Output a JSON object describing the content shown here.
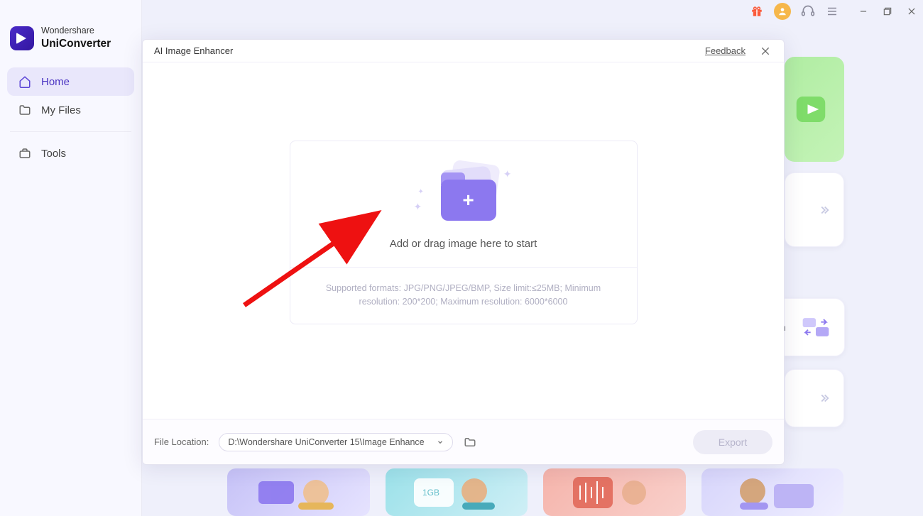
{
  "brand": {
    "line1": "Wondershare",
    "line2": "UniConverter"
  },
  "sidebar": {
    "items": [
      {
        "label": "Home",
        "icon": "home-icon",
        "active": true
      },
      {
        "label": "My Files",
        "icon": "folder-icon",
        "active": false
      },
      {
        "label": "Tools",
        "icon": "toolbox-icon",
        "active": false
      }
    ]
  },
  "modal": {
    "title": "AI Image Enhancer",
    "feedback_label": "Feedback",
    "drop_prompt": "Add or drag image here to start",
    "format_hint": "Supported formats: JPG/PNG/JPEG/BMP, Size limit:≤25MB; Minimum resolution: 200*200; Maximum resolution: 6000*6000",
    "footer": {
      "file_location_label": "File Location:",
      "path": "D:\\Wondershare UniConverter 15\\Image Enhance",
      "export_label": "Export"
    }
  },
  "bg": {
    "card_text": "n"
  },
  "colors": {
    "accent": "#8c78ef",
    "sidebar_active_bg": "#e9e7fb",
    "export_disabled_bg": "#edecf6"
  }
}
